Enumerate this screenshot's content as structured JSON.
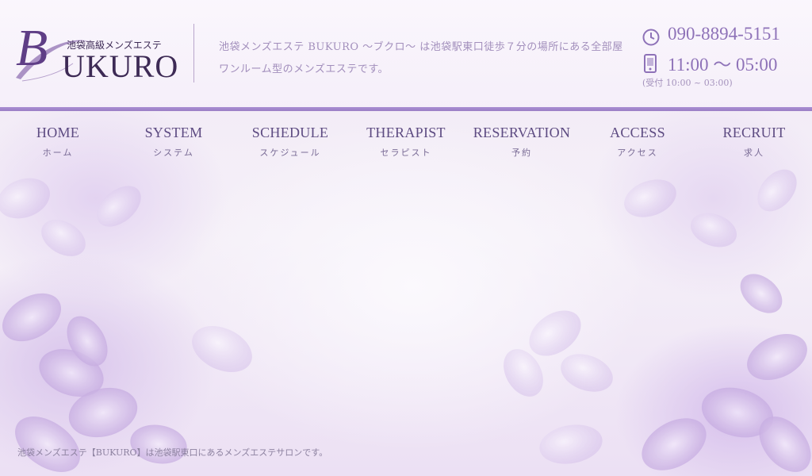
{
  "logo": {
    "letter": "B",
    "word": "UKURO",
    "tagline": "池袋高級メンズエステ"
  },
  "header": {
    "description": "池袋メンズエステ BUKURO 〜ブクロ〜 は池袋駅東口徒歩７分の場所にある全部屋ワンルーム型のメンズエステです。"
  },
  "contact": {
    "phone": "090-8894-5151",
    "hours": "11:00 ～ 05:00",
    "reception": "(受付 10:00 ~ 03:00)"
  },
  "nav": [
    {
      "en": "HOME",
      "jp": "ホーム"
    },
    {
      "en": "SYSTEM",
      "jp": "システム"
    },
    {
      "en": "SCHEDULE",
      "jp": "スケジュール"
    },
    {
      "en": "THERAPIST",
      "jp": "セラピスト"
    },
    {
      "en": "RESERVATION",
      "jp": "予約"
    },
    {
      "en": "ACCESS",
      "jp": "アクセス"
    },
    {
      "en": "RECRUIT",
      "jp": "求人"
    }
  ],
  "footer": {
    "text": "池袋メンズエステ【BUKURO】は池袋駅東口にあるメンズエステサロンです。"
  },
  "colors": {
    "accent": "#9a7fc6",
    "nav_text": "#5d4b82",
    "contact_text": "#8e72b8"
  },
  "icons": {
    "clock": "clock-icon",
    "phone": "mobile-phone-icon"
  }
}
